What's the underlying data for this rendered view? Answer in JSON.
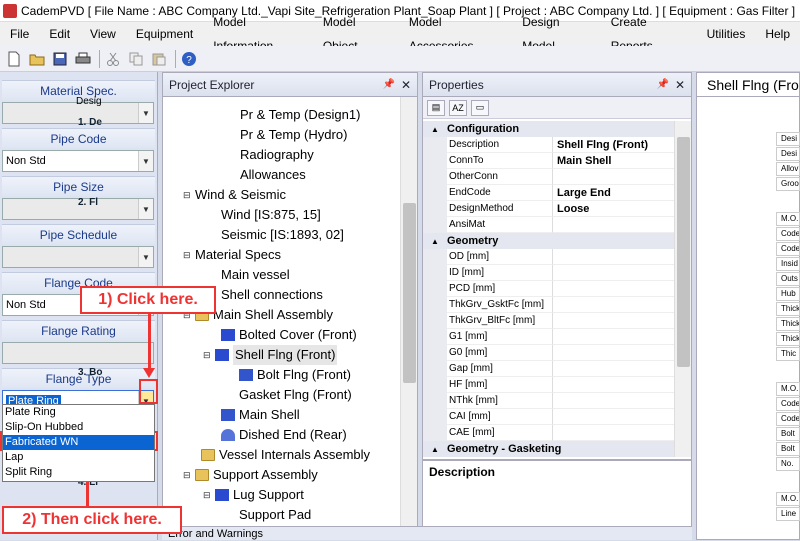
{
  "window": {
    "title": "CademPVD [ File Name : ABC Company Ltd._Vapi Site_Refrigeration Plant_Soap Plant ] [ Project : ABC Company Ltd. ] [ Equipment : Gas Filter ]"
  },
  "menu": [
    "File",
    "Edit",
    "View",
    "Equipment",
    "Model Information",
    "Model Object",
    "Model Accessories",
    "Design Model",
    "Create Reports",
    "Utilities",
    "Help"
  ],
  "toolbar": [
    "new-icon",
    "open-icon",
    "save-icon",
    "print-icon",
    "cut-icon",
    "copy-icon",
    "paste-icon",
    "help-icon"
  ],
  "left_panel": {
    "material_spec": {
      "label": "Material Spec.",
      "value": ""
    },
    "pipe_code": {
      "label": "Pipe Code",
      "value": "Non Std"
    },
    "pipe_size": {
      "label": "Pipe Size",
      "value": ""
    },
    "pipe_schedule": {
      "label": "Pipe Schedule",
      "value": ""
    },
    "flange_code": {
      "label": "Flange Code",
      "value": "Non Std"
    },
    "flange_rating": {
      "label": "Flange Rating",
      "value": ""
    },
    "flange_type": {
      "label": "Flange Type",
      "value": "Plate Ring"
    },
    "flange_type_options": [
      "Plate Ring",
      "Slip-On Hubbed",
      "Fabricated WN",
      "Lap",
      "Split Ring"
    ]
  },
  "explorer": {
    "title": "Project Explorer",
    "items": [
      {
        "label": "Pr & Temp (Design1)"
      },
      {
        "label": "Pr & Temp (Hydro)"
      },
      {
        "label": "Radiography"
      },
      {
        "label": "Allowances"
      },
      {
        "label": "Wind & Seismic"
      },
      {
        "label": "Wind [IS:875, 15]"
      },
      {
        "label": "Seismic [IS:1893, 02]"
      },
      {
        "label": "Material Specs"
      },
      {
        "label": "Main vessel"
      },
      {
        "label": "Shell connections"
      },
      {
        "label": "Main Shell Assembly"
      },
      {
        "label": "Bolted Cover (Front)"
      },
      {
        "label": "Shell Flng (Front)"
      },
      {
        "label": "Bolt Flng (Front)"
      },
      {
        "label": "Gasket Flng (Front)"
      },
      {
        "label": "Main Shell"
      },
      {
        "label": "Dished End (Rear)"
      },
      {
        "label": "Vessel Internals Assembly"
      },
      {
        "label": "Support Assembly"
      },
      {
        "label": "Lug Support"
      },
      {
        "label": "Support Pad"
      }
    ]
  },
  "properties": {
    "title": "Properties",
    "categories": {
      "configuration": "Configuration",
      "geometry": "Geometry",
      "geometry_gasketing": "Geometry - Gasketing"
    },
    "config_rows": [
      {
        "k": "Description",
        "v": "Shell Flng (Front)"
      },
      {
        "k": "ConnTo",
        "v": "Main Shell"
      },
      {
        "k": "OtherConn",
        "v": ""
      },
      {
        "k": "EndCode",
        "v": "Large End"
      },
      {
        "k": "DesignMethod",
        "v": "Loose"
      },
      {
        "k": "AnsiMat",
        "v": ""
      }
    ],
    "geometry_rows": [
      {
        "k": "OD [mm]",
        "v": ""
      },
      {
        "k": "ID [mm]",
        "v": ""
      },
      {
        "k": "PCD [mm]",
        "v": ""
      },
      {
        "k": "ThkGrv_GsktFc [mm]",
        "v": ""
      },
      {
        "k": "ThkGrv_BltFc [mm]",
        "v": ""
      },
      {
        "k": "G1 [mm]",
        "v": ""
      },
      {
        "k": "G0 [mm]",
        "v": ""
      },
      {
        "k": "Gap [mm]",
        "v": ""
      },
      {
        "k": "HF [mm]",
        "v": ""
      },
      {
        "k": "NThk [mm]",
        "v": ""
      },
      {
        "k": "CAI [mm]",
        "v": ""
      },
      {
        "k": "CAE [mm]",
        "v": ""
      }
    ],
    "description_label": "Description"
  },
  "right_panel": {
    "tab": "Shell Flng (Front)",
    "top_cut": "Desig",
    "sec1": "1. De",
    "sec1_rows": [
      "Desi",
      "Desi",
      "Allov",
      "Groo"
    ],
    "sec2": "2. Fl",
    "sec2_rows": [
      "M.O.",
      "Code",
      "Code",
      "Insid",
      "Outs",
      "Hub",
      "Thick",
      "Thick",
      "Thick",
      "Thic"
    ],
    "sec3": "3. Bo",
    "sec3_rows": [
      "M.O.",
      "Code",
      "Code",
      "Bolt",
      "Bolt",
      "No."
    ],
    "sec4": "4. Li",
    "sec4_rows": [
      "M.O.",
      "Line"
    ]
  },
  "bottom_pane": {
    "title": "Error and Warnings"
  },
  "annotations": {
    "step1": "1) Click here.",
    "step2": "2) Then click here."
  }
}
